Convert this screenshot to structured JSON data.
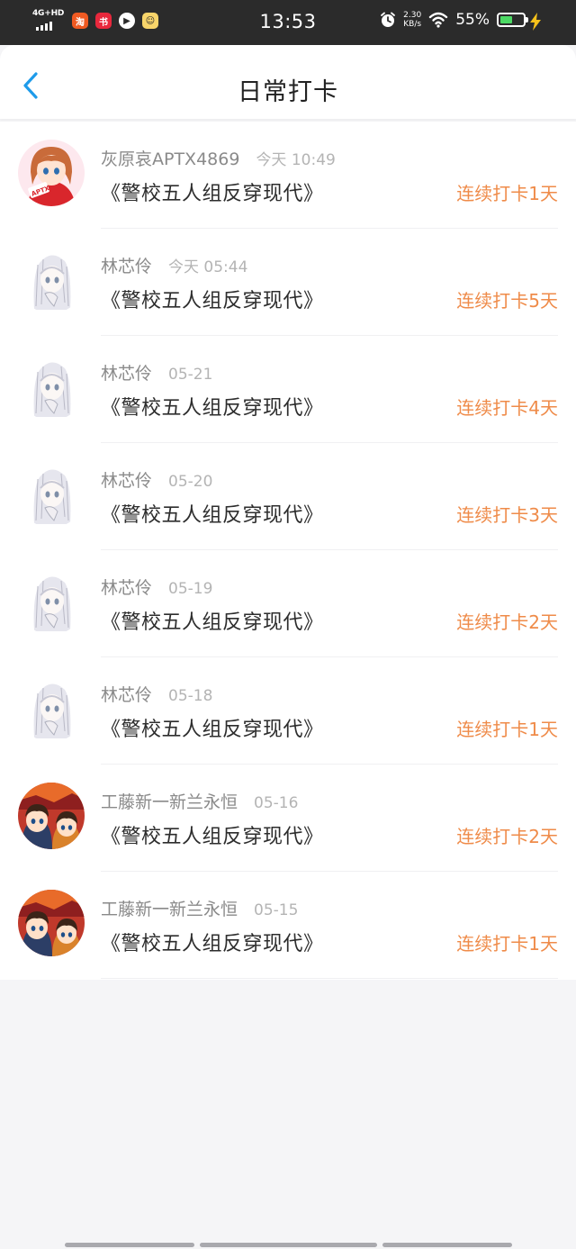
{
  "status_bar": {
    "network_label": "4G+HD",
    "time": "13:53",
    "speed_value": "2.30",
    "speed_unit": "KB/s",
    "battery_percent": "55%",
    "battery_level": 0.55,
    "app_icons": [
      {
        "name": "taobao-app-icon",
        "color": "#f05a22",
        "glyph": "淘"
      },
      {
        "name": "xiaohongshu-app-icon",
        "color": "#e8283c",
        "glyph": "书"
      },
      {
        "name": "video-app-icon",
        "color": "#ffffff",
        "glyph": "▶"
      },
      {
        "name": "avatar-app-icon",
        "color": "#f7d46a",
        "glyph": "☺"
      }
    ]
  },
  "header": {
    "title": "日常打卡",
    "back_icon": "chevron-left-icon"
  },
  "accent_color": "#ef8b49",
  "checkins": [
    {
      "username": "灰原哀APTX4869",
      "time": "今天 10:49",
      "book": "《警校五人组反穿现代》",
      "streak": "连续打卡1天",
      "avatar": "red-hair-girl-avatar"
    },
    {
      "username": "林芯伶",
      "time": "今天 05:44",
      "book": "《警校五人组反穿现代》",
      "streak": "连续打卡5天",
      "avatar": "sketch-girl-avatar"
    },
    {
      "username": "林芯伶",
      "time": "05-21",
      "book": "《警校五人组反穿现代》",
      "streak": "连续打卡4天",
      "avatar": "sketch-girl-avatar"
    },
    {
      "username": "林芯伶",
      "time": "05-20",
      "book": "《警校五人组反穿现代》",
      "streak": "连续打卡3天",
      "avatar": "sketch-girl-avatar"
    },
    {
      "username": "林芯伶",
      "time": "05-19",
      "book": "《警校五人组反穿现代》",
      "streak": "连续打卡2天",
      "avatar": "sketch-girl-avatar"
    },
    {
      "username": "林芯伶",
      "time": "05-18",
      "book": "《警校五人组反穿现代》",
      "streak": "连续打卡1天",
      "avatar": "sketch-girl-avatar"
    },
    {
      "username": "工藤新一新兰永恒",
      "time": "05-16",
      "book": "《警校五人组反穿现代》",
      "streak": "连续打卡2天",
      "avatar": "anime-duo-avatar"
    },
    {
      "username": "工藤新一新兰永恒",
      "time": "05-15",
      "book": "《警校五人组反穿现代》",
      "streak": "连续打卡1天",
      "avatar": "anime-duo-avatar"
    }
  ]
}
